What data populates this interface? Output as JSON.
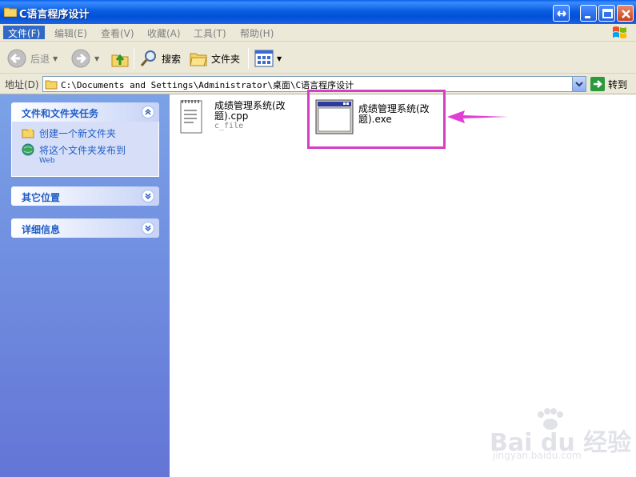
{
  "window": {
    "title": "C语言程序设计"
  },
  "menu": {
    "items": [
      {
        "label": "文件(F)",
        "active": true
      },
      {
        "label": "编辑(E)"
      },
      {
        "label": "查看(V)"
      },
      {
        "label": "收藏(A)"
      },
      {
        "label": "工具(T)"
      },
      {
        "label": "帮助(H)"
      }
    ]
  },
  "toolbar": {
    "back_label": "后退",
    "search_label": "搜索",
    "folders_label": "文件夹"
  },
  "address": {
    "label": "地址(D)",
    "path": "C:\\Documents and Settings\\Administrator\\桌面\\C语言程序设计",
    "go_label": "转到"
  },
  "leftpane": {
    "tasks_panel": {
      "title": "文件和文件夹任务",
      "items": [
        {
          "label": "创建一个新文件夹",
          "icon": "new-folder-icon"
        },
        {
          "label": "将这个文件夹发布到",
          "sub": "Web",
          "icon": "publish-web-icon"
        }
      ]
    },
    "other_places": {
      "title": "其它位置"
    },
    "details": {
      "title": "详细信息"
    }
  },
  "files": [
    {
      "name_line1": "成绩管理系统(改",
      "name_line2": "题).cpp",
      "type": "c_file",
      "icon": "text-document-icon"
    },
    {
      "name_line1": "成绩管理系统(改",
      "name_line2": "题).exe",
      "icon": "application-window-icon"
    }
  ],
  "watermark": {
    "text": "Bai du 经验",
    "sub": "jingyan.baidu.com"
  },
  "colors": {
    "titlebar": "#0a5ee0",
    "highlight": "#d63ec8",
    "panel_title": "#215dc6"
  }
}
